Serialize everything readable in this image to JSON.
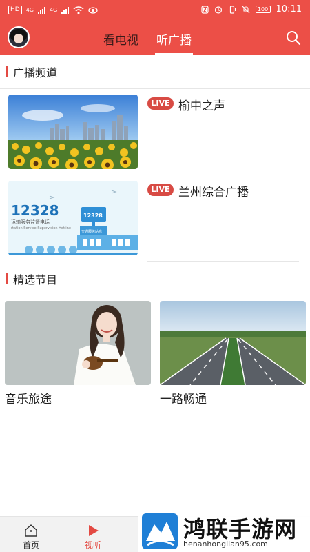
{
  "status_bar": {
    "time": "10:11",
    "battery": "100",
    "network_chip": "HD",
    "network_type_1": "4G",
    "network_type_2": "4G"
  },
  "header": {
    "tabs": [
      {
        "label": "看电视",
        "active": false
      },
      {
        "label": "听广播",
        "active": true
      }
    ]
  },
  "sections": {
    "channels_title": "广播频道",
    "programs_title": "精选节目"
  },
  "channels": [
    {
      "live_label": "LIVE",
      "name": "榆中之声"
    },
    {
      "live_label": "LIVE",
      "name": "兰州综合广播",
      "thumb_text_big": "12328",
      "thumb_text_cn": "运输服务监督电话",
      "thumb_text_en": "rtation Service Supervision Hotline",
      "thumb_text_small": "交通服务站点"
    }
  ],
  "programs": [
    {
      "title": "音乐旅途"
    },
    {
      "title": "一路畅通"
    }
  ],
  "bottom_nav": [
    {
      "label": "首页",
      "active": false
    },
    {
      "label": "视听",
      "active": true
    }
  ],
  "watermark": {
    "text": "鸿联手游网",
    "url": "henanhonglian95.com"
  },
  "colors": {
    "brand_red": "#ec4f47",
    "live_badge": "#d84b44",
    "active_nav": "#e34a43"
  }
}
